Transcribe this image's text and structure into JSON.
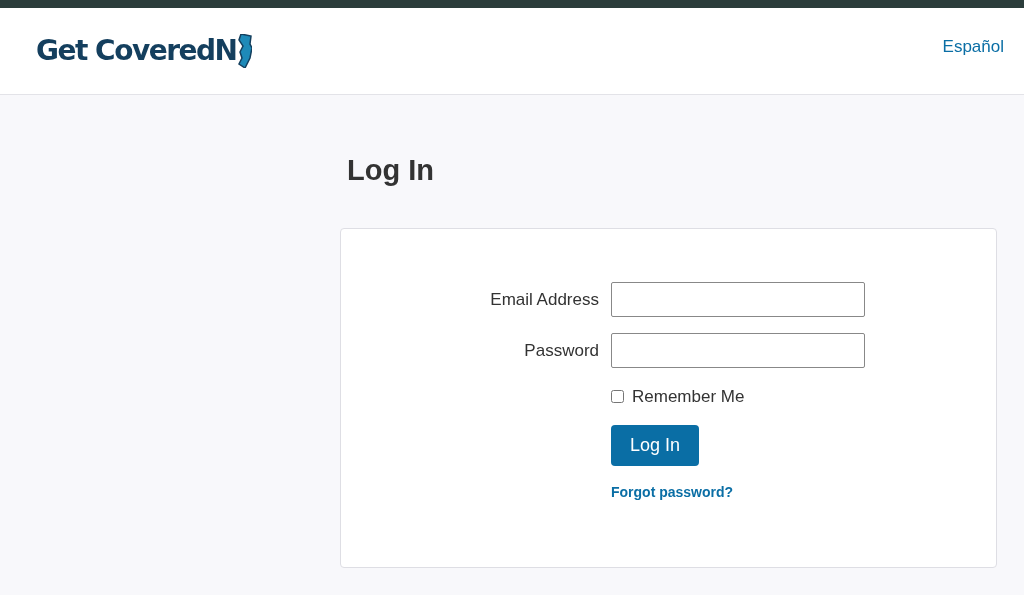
{
  "header": {
    "logo_text": "Get Covered",
    "logo_mark": "N",
    "language_link": "Español"
  },
  "page_title": "Log In",
  "form": {
    "fields": [
      {
        "label": "Email Address"
      },
      {
        "label": "Password"
      }
    ],
    "remember": {
      "label": "Remember Me",
      "checked": false
    },
    "submit": "Log In",
    "forgot_link": "Forgot password?"
  }
}
